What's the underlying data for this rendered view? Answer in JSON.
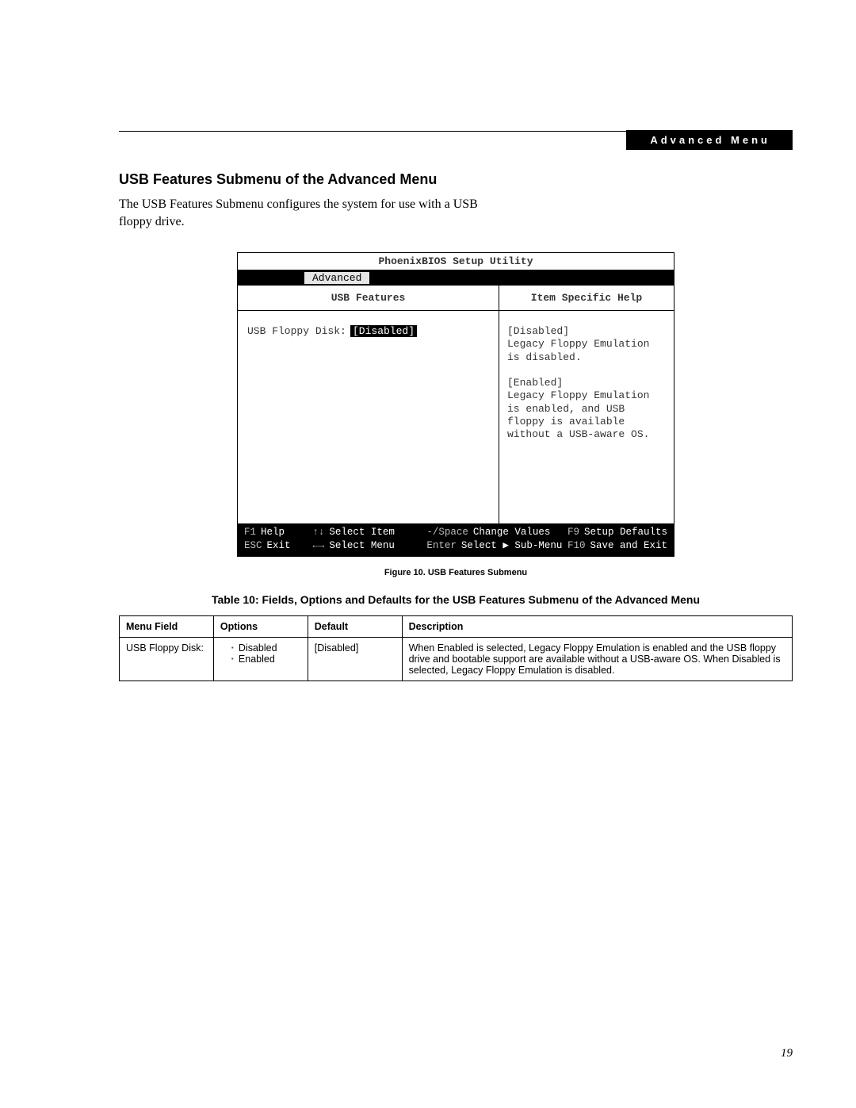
{
  "header_tag": "Advanced Menu",
  "section_title": "USB Features Submenu of the Advanced Menu",
  "body_text": "The USB Features Submenu configures the system for use with a USB floppy drive.",
  "bios": {
    "title": "PhoenixBIOS Setup Utility",
    "active_tab": "Advanced",
    "left_pane_title": "USB Features",
    "right_pane_title": "Item Specific Help",
    "setting_label": "USB Floppy Disk:",
    "setting_value": "[Disabled]",
    "help_text": "[Disabled]\nLegacy Floppy Emulation is disabled.\n\n[Enabled]\nLegacy Floppy Emulation is enabled, and USB floppy is available without a USB-aware OS.",
    "footer": {
      "row1": [
        {
          "key": "F1",
          "label": "Help"
        },
        {
          "key": "↑↓",
          "label": "Select Item"
        },
        {
          "key": "-/Space",
          "label": "Change Values"
        },
        {
          "key": "F9",
          "label": "Setup Defaults"
        }
      ],
      "row2": [
        {
          "key": "ESC",
          "label": "Exit"
        },
        {
          "key": "←→",
          "label": "Select Menu"
        },
        {
          "key": "Enter",
          "label": "Select ▶ Sub-Menu"
        },
        {
          "key": "F10",
          "label": "Save and Exit"
        }
      ]
    }
  },
  "figure_caption": "Figure 10.  USB Features Submenu",
  "table_title": "Table 10: Fields, Options and Defaults for the USB Features Submenu of the Advanced Menu",
  "table": {
    "headers": [
      "Menu Field",
      "Options",
      "Default",
      "Description"
    ],
    "row": {
      "menu_field": "USB Floppy Disk:",
      "options": [
        "Disabled",
        "Enabled"
      ],
      "default": "[Disabled]",
      "description": "When Enabled is selected, Legacy Floppy Emulation is enabled and the USB floppy drive and bootable support are available without a USB-aware OS. When Disabled is selected, Legacy Floppy Emulation is disabled."
    }
  },
  "page_number": "19"
}
